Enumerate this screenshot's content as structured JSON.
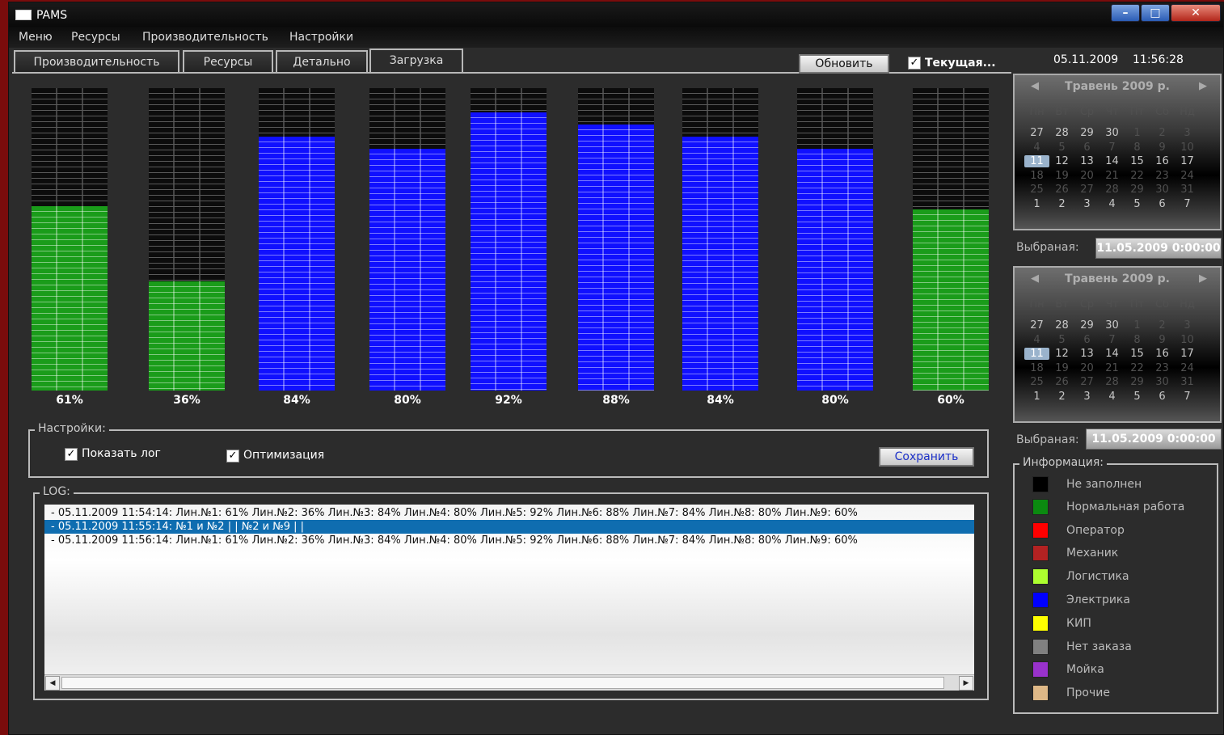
{
  "window": {
    "title": "PAMS"
  },
  "menu": [
    "Меню",
    "Ресурсы",
    "Производительность",
    "Настройки"
  ],
  "tabs": [
    "Производительность",
    "Ресурсы",
    "Детально",
    "Загрузка"
  ],
  "active_tab": "Загрузка",
  "toolbar": {
    "refresh_label": "Обновить",
    "current_label": "Текущая..."
  },
  "datetime": {
    "date": "05.11.2009",
    "time": "11:56:28"
  },
  "lines": [
    {
      "label": "61%",
      "value": 61,
      "color": "#1a9c1a"
    },
    {
      "label": "36%",
      "value": 36,
      "color": "#1a9c1a"
    },
    {
      "label": "84%",
      "value": 84,
      "color": "#1010ff"
    },
    {
      "label": "80%",
      "value": 80,
      "color": "#1010ff"
    },
    {
      "label": "92%",
      "value": 92,
      "color": "#1010ff"
    },
    {
      "label": "88%",
      "value": 88,
      "color": "#1010ff"
    },
    {
      "label": "84%",
      "value": 84,
      "color": "#1010ff"
    },
    {
      "label": "80%",
      "value": 80,
      "color": "#1010ff"
    },
    {
      "label": "60%",
      "value": 60,
      "color": "#1a9c1a"
    }
  ],
  "settings": {
    "title": "Настройки:",
    "show_log_label": "Показать лог",
    "optimization_label": "Оптимизация",
    "save_label": "Сохранить",
    "show_log_checked": true,
    "optimization_checked": true
  },
  "log": {
    "title": "LOG:",
    "entries": [
      "- 05.11.2009    11:54:14:  Лин.№1: 61% Лин.№2: 36% Лин.№3: 84% Лин.№4: 80% Лин.№5: 92% Лин.№6: 88% Лин.№7: 84% Лин.№8: 80% Лин.№9: 60%",
      "- 05.11.2009    11:55:14: №1 и №2   | |   №2 и №9   | |",
      "- 05.11.2009    11:56:14:  Лин.№1: 61% Лин.№2: 36% Лин.№3: 84% Лин.№4: 80% Лин.№5: 92% Лин.№6: 88% Лин.№7: 84% Лин.№8: 80% Лин.№9: 60%"
    ],
    "selected_index": 1
  },
  "calendar1": {
    "month": "Травень 2009 р.",
    "weekdays": [
      "Пн",
      "Вт",
      "Ср",
      "Чт",
      "Пт",
      "Сб",
      "Нд"
    ],
    "rows": [
      [
        "27",
        "28",
        "29",
        "30",
        "1",
        "2",
        "3"
      ],
      [
        "4",
        "5",
        "6",
        "7",
        "8",
        "9",
        "10"
      ],
      [
        "11",
        "12",
        "13",
        "14",
        "15",
        "16",
        "17"
      ],
      [
        "18",
        "19",
        "20",
        "21",
        "22",
        "23",
        "24"
      ],
      [
        "25",
        "26",
        "27",
        "28",
        "29",
        "30",
        "31"
      ],
      [
        "1",
        "2",
        "3",
        "4",
        "5",
        "6",
        "7"
      ]
    ],
    "selected_day": "11"
  },
  "calendar2": {
    "month": "Травень 2009 р.",
    "weekdays": [
      "Пн",
      "Вт",
      "Ср",
      "Чт",
      "Пт",
      "Сб",
      "Нд"
    ],
    "rows": [
      [
        "27",
        "28",
        "29",
        "30",
        "1",
        "2",
        "3"
      ],
      [
        "4",
        "5",
        "6",
        "7",
        "8",
        "9",
        "10"
      ],
      [
        "11",
        "12",
        "13",
        "14",
        "15",
        "16",
        "17"
      ],
      [
        "18",
        "19",
        "20",
        "21",
        "22",
        "23",
        "24"
      ],
      [
        "25",
        "26",
        "27",
        "28",
        "29",
        "30",
        "31"
      ],
      [
        "1",
        "2",
        "3",
        "4",
        "5",
        "6",
        "7"
      ]
    ],
    "selected_day": "11"
  },
  "selection": {
    "label": "Выбраная:",
    "value1": "11.05.2009 0:00:00",
    "value2": "11.05.2009 0:00:00"
  },
  "info": {
    "title": "Информация:",
    "items": [
      {
        "label": "Не заполнен",
        "color": "#000000"
      },
      {
        "label": "Нормальная работа",
        "color": "#0b8a10"
      },
      {
        "label": "Оператор",
        "color": "#ff0000"
      },
      {
        "label": "Механик",
        "color": "#b22222"
      },
      {
        "label": "Логистика",
        "color": "#adff2f"
      },
      {
        "label": "Электрика",
        "color": "#0000ff"
      },
      {
        "label": "КИП",
        "color": "#ffff00"
      },
      {
        "label": "Нет заказа",
        "color": "#808080"
      },
      {
        "label": "Мойка",
        "color": "#9932cc"
      },
      {
        "label": "Прочие",
        "color": "#deb887"
      }
    ]
  }
}
